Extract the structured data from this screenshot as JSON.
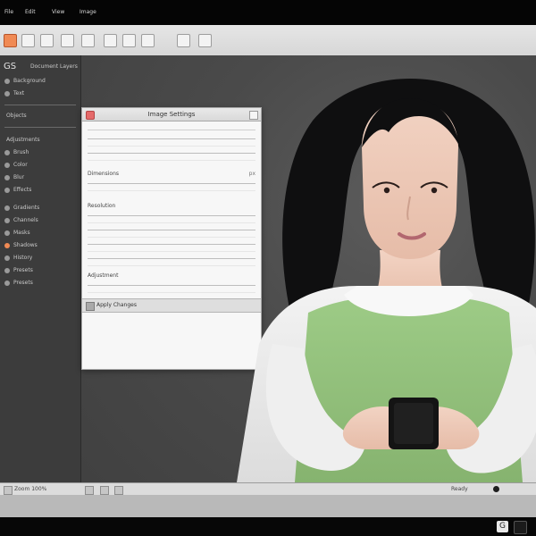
{
  "menubar": {
    "items": [
      "File",
      "Edit",
      "View",
      "Image"
    ]
  },
  "toolbar": {
    "buttons": [
      "app-icon",
      "crop-icon",
      "brush-icon",
      "text-icon",
      "tag-icon",
      "eraser-icon",
      "filter-icon",
      "select-icon",
      "zoom-icon"
    ]
  },
  "panel": {
    "logo": "GS",
    "items": [
      "Document Layers",
      "Background",
      "Text",
      "Objects",
      "Adjustments",
      "Brush",
      "Color",
      "Blur",
      "Effects",
      "Gradients",
      "Channels",
      "Masks",
      "Shadows",
      "History",
      "Presets"
    ]
  },
  "dialog": {
    "title": "Image Settings",
    "labels": [
      "Dimensions",
      "Resolution",
      "Adjustment"
    ],
    "right_label": "px",
    "footer_text": "Apply Changes"
  },
  "statusbar": {
    "left": "Zoom 100%",
    "right": "Ready"
  },
  "taskbar": {
    "tray_label": "G"
  },
  "colors": {
    "accent": "#f08a54",
    "dialog_bg": "#f7f7f7",
    "canvas_bg": "#4a4a4a",
    "dress_green": "#93c07a"
  }
}
